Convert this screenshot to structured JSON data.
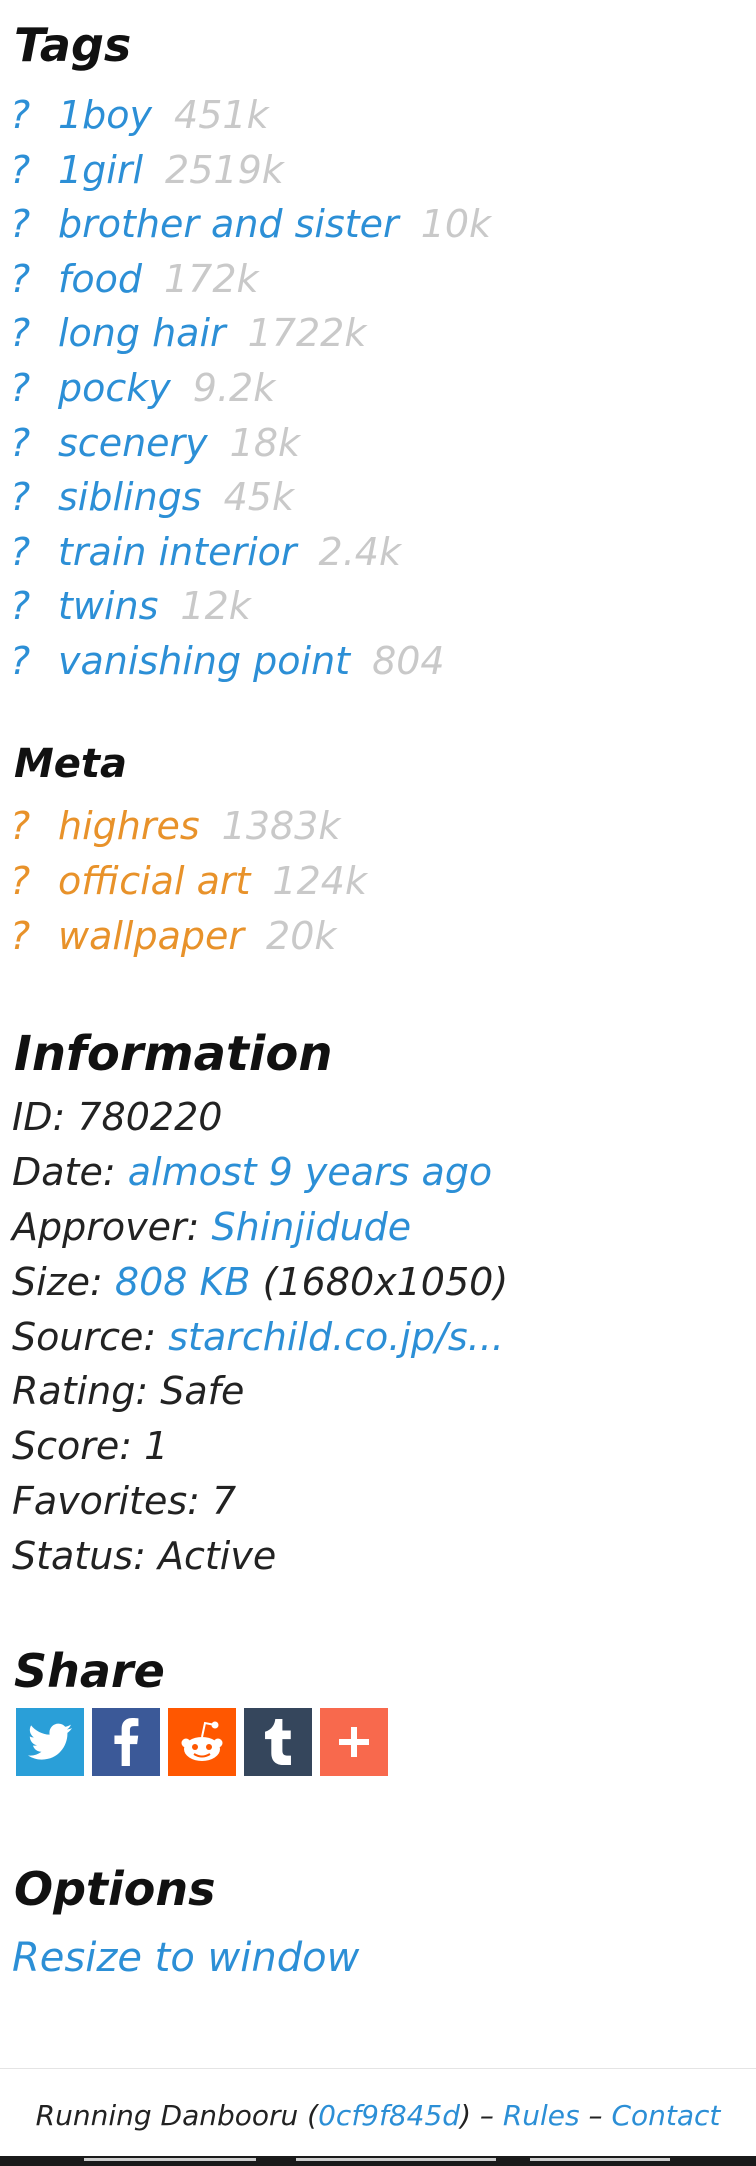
{
  "tags_section": {
    "title": "Tags",
    "question_mark": "?",
    "items": [
      {
        "name": "1boy",
        "count": "451k"
      },
      {
        "name": "1girl",
        "count": "2519k"
      },
      {
        "name": "brother and sister",
        "count": "10k"
      },
      {
        "name": "food",
        "count": "172k"
      },
      {
        "name": "long hair",
        "count": "1722k"
      },
      {
        "name": "pocky",
        "count": "9.2k"
      },
      {
        "name": "scenery",
        "count": "18k"
      },
      {
        "name": "siblings",
        "count": "45k"
      },
      {
        "name": "train interior",
        "count": "2.4k"
      },
      {
        "name": "twins",
        "count": "12k"
      },
      {
        "name": "vanishing point",
        "count": "804"
      }
    ]
  },
  "meta_section": {
    "title": "Meta",
    "question_mark": "?",
    "items": [
      {
        "name": "highres",
        "count": "1383k"
      },
      {
        "name": "official art",
        "count": "124k"
      },
      {
        "name": "wallpaper",
        "count": "20k"
      }
    ]
  },
  "information": {
    "title": "Information",
    "id_label": "ID:",
    "id_value": "780220",
    "date_label": "Date:",
    "date_value": "almost 9 years ago",
    "approver_label": "Approver:",
    "approver_value": "Shinjidude",
    "size_label": "Size:",
    "size_value": "808 KB",
    "size_dimensions": "(1680x1050)",
    "source_label": "Source:",
    "source_value": "starchild.co.jp/s...",
    "rating_label": "Rating:",
    "rating_value": "Safe",
    "score_label": "Score:",
    "score_value": "1",
    "favorites_label": "Favorites:",
    "favorites_value": "7",
    "status_label": "Status:",
    "status_value": "Active"
  },
  "share": {
    "title": "Share",
    "buttons": [
      {
        "icon": "twitter-icon",
        "color": "#2a9fd8"
      },
      {
        "icon": "facebook-icon",
        "color": "#3b5998"
      },
      {
        "icon": "reddit-icon",
        "color": "#ff5700"
      },
      {
        "icon": "tumblr-icon",
        "color": "#35465c"
      },
      {
        "icon": "addthis-plus-icon",
        "color": "#f8694d"
      }
    ]
  },
  "options": {
    "title": "Options",
    "resize_link": "Resize to window"
  },
  "footer": {
    "running": "Running Danbooru (",
    "commit": "0cf9f845d",
    "close_paren": ")",
    "sep1": " – ",
    "rules": "Rules",
    "sep2": " – ",
    "contact": "Contact"
  },
  "colors": {
    "general_tag": "#2c8fd6",
    "meta_tag": "#e8922a",
    "count": "#c9c9c9",
    "link": "#2c8fd6",
    "text": "#222222"
  }
}
